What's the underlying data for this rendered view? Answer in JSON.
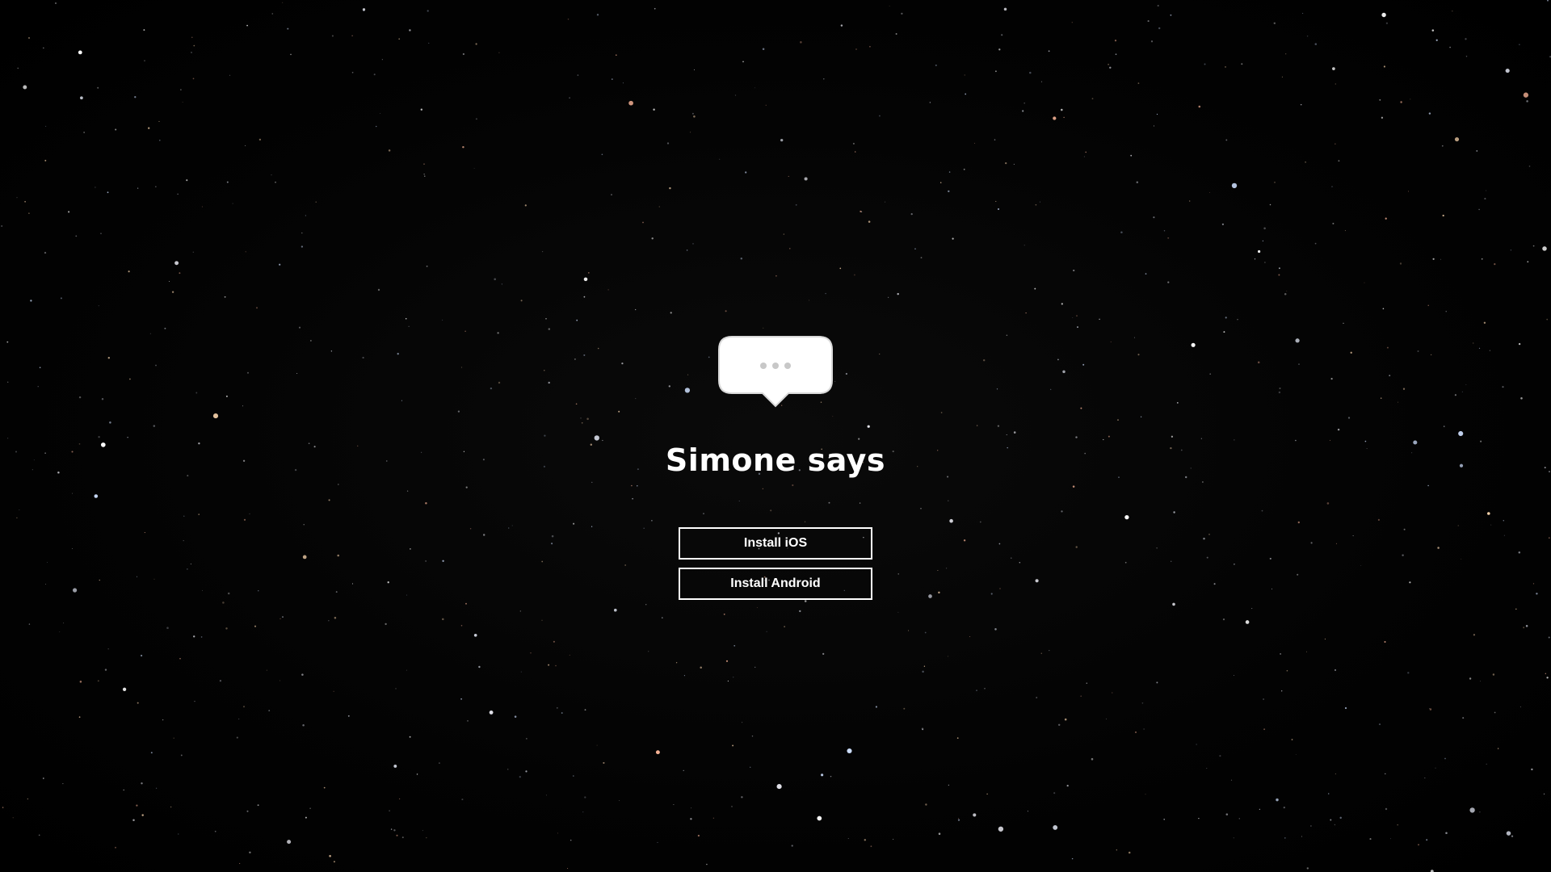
{
  "app": {
    "title": "Simone says"
  },
  "buttons": {
    "install_ios": "Install iOS",
    "install_android": "Install Android"
  },
  "icons": {
    "logo": "speech-bubble-icon",
    "background": "starfield"
  },
  "colors": {
    "background": "#000000",
    "text": "#ffffff",
    "button_border": "#ffffff",
    "bubble_dots": "#c8c8c8"
  }
}
